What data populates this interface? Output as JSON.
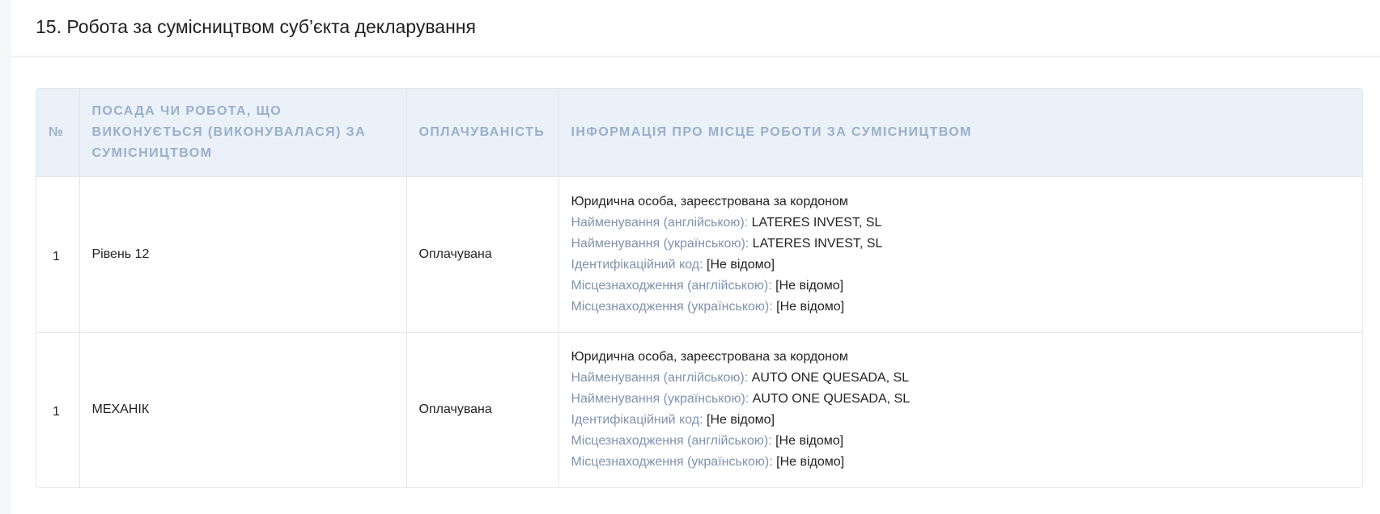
{
  "section": {
    "title": "15. Робота за сумісництвом суб’єкта декларування"
  },
  "table": {
    "headers": {
      "num": "№",
      "position": "Посада чи робота, що виконується (виконувалася) за сумісництвом",
      "paid": "Оплачуваність",
      "info": "Інформація про місце роботи за сумісництвом"
    },
    "rows": [
      {
        "num": "1",
        "position": "Рівень 12",
        "paid": "Оплачувана",
        "entity_type": "Юридична особа, зареєстрована за кордоном",
        "name_en_label": "Найменування (англійською):",
        "name_en": "LATERES INVEST, SL",
        "name_uk_label": "Найменування (українською):",
        "name_uk": "LATERES INVEST, SL",
        "code_label": "Ідентифікаційний код:",
        "code": "[Не відомо]",
        "loc_en_label": "Місцезнаходження (англійською):",
        "loc_en": "[Не відомо]",
        "loc_uk_label": "Місцезнаходження (українською):",
        "loc_uk": "[Не відомо]"
      },
      {
        "num": "1",
        "position": "МЕХАНІК",
        "paid": "Оплачувана",
        "entity_type": "Юридична особа, зареєстрована за кордоном",
        "name_en_label": "Найменування (англійською):",
        "name_en": "AUTO ONE QUESADA, SL",
        "name_uk_label": "Найменування (українською):",
        "name_uk": "AUTO ONE QUESADA, SL",
        "code_label": "Ідентифікаційний код:",
        "code": "[Не відомо]",
        "loc_en_label": "Місцезнаходження (англійською):",
        "loc_en": "[Не відомо]",
        "loc_uk_label": "Місцезнаходження (українською):",
        "loc_uk": "[Не відомо]"
      }
    ]
  },
  "colors": {
    "header_bg": "#eaf1f8",
    "header_text": "#9aafca",
    "label_text": "#7f93b0"
  }
}
